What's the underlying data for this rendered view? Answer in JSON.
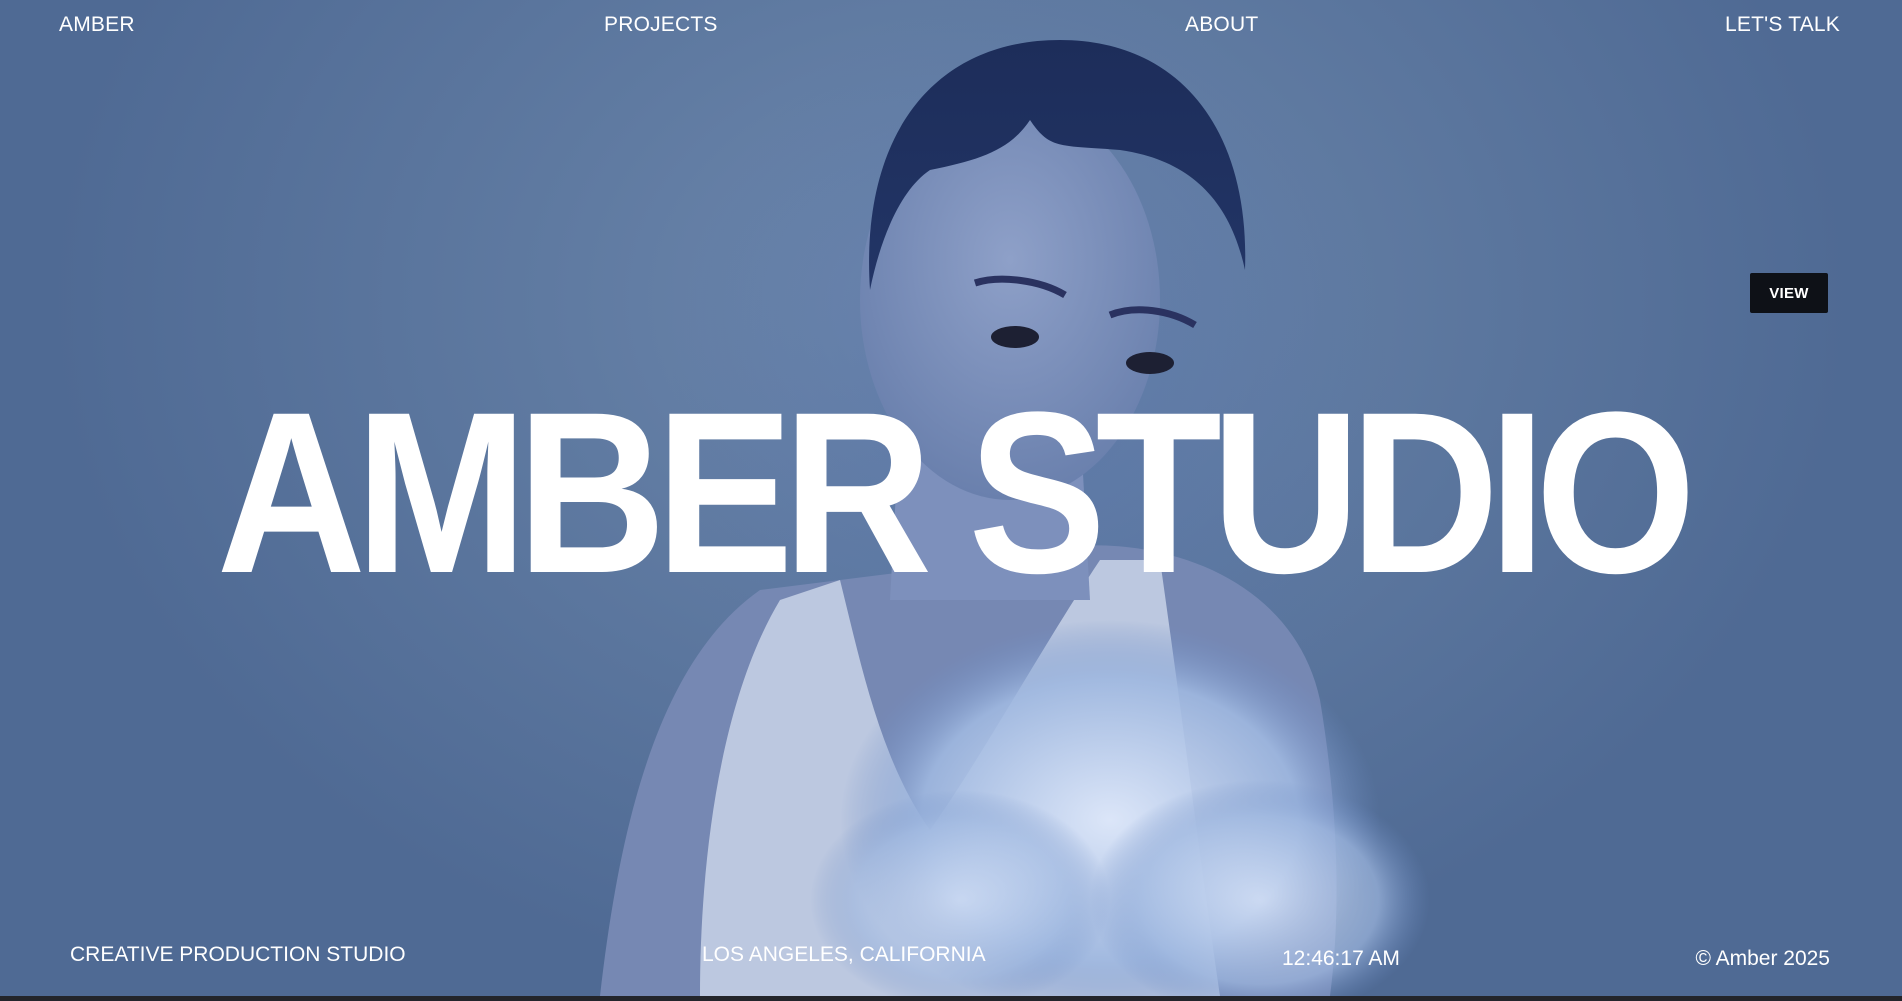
{
  "nav": {
    "logo": "AMBER",
    "projects": "PROJECTS",
    "about": "ABOUT",
    "contact": "LET'S TALK"
  },
  "hero": {
    "title": "AMBER STUDIO",
    "view_button": "VIEW"
  },
  "footer": {
    "tagline": "CREATIVE PRODUCTION STUDIO",
    "location": "LOS ANGELES, CALIFORNIA",
    "clock": "12:46:17 AM",
    "copyright": "© Amber 2025"
  },
  "colors": {
    "background": "#6079a0",
    "text": "#ffffff",
    "view_button_bg": "#0e1117"
  }
}
